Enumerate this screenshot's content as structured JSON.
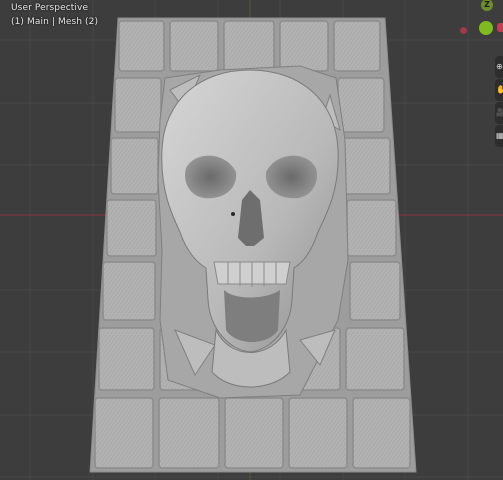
{
  "viewport": {
    "title": "User Perspective",
    "collection_info": "(1) Main | Mesh (2)"
  },
  "gizmo": {
    "z_label": "Z",
    "axis_colors": {
      "x": "#c43e52",
      "y": "#7fba1e",
      "z": "#6e8d2c"
    }
  },
  "nav_tools": [
    {
      "name": "zoom-icon",
      "glyph": "⊕"
    },
    {
      "name": "hand-pan-icon",
      "glyph": "✋"
    },
    {
      "name": "camera-view-icon",
      "glyph": "🎥"
    },
    {
      "name": "perspective-toggle-icon",
      "glyph": "▦"
    }
  ],
  "colors": {
    "background": "#3d3d3d",
    "grid_line": "#474747",
    "x_axis_line": "#8a3440",
    "mesh_base": "#a9a9a9",
    "tile_face": "#b4b4b4"
  }
}
